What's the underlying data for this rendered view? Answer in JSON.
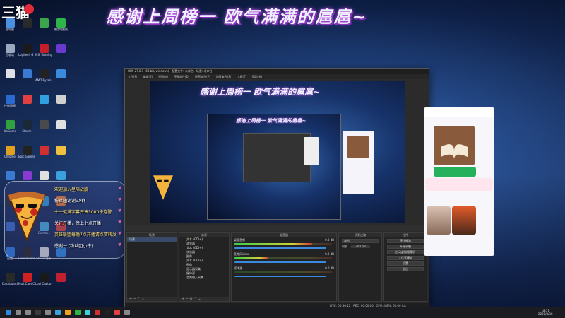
{
  "banner": {
    "text": "感谢上周榜一 欧气满满的扈扈~"
  },
  "logo": {
    "text": "三猫"
  },
  "desktop": {
    "icons": [
      {
        "label": "此电脑",
        "color": "#4a8fe0"
      },
      {
        "label": "",
        "color": "#2a2a2a"
      },
      {
        "label": "",
        "color": "#3aa54a"
      },
      {
        "label": "微信电脑版",
        "color": "#2db54a"
      },
      {
        "label": "回收站",
        "color": "#9aa8c0"
      },
      {
        "label": "Logitech G HUB",
        "color": "#1a1a1a"
      },
      {
        "label": "MSI Gaming APP",
        "color": "#c41e2a"
      },
      {
        "label": "",
        "color": "#6a3ad0"
      },
      {
        "label": "",
        "color": "#e0e0e8"
      },
      {
        "label": "",
        "color": "#3a7ad0"
      },
      {
        "label": "AMD Ryzen Master",
        "color": "#222"
      },
      {
        "label": "",
        "color": "#3a8ae0"
      },
      {
        "label": "控制面板",
        "color": "#2a6ad0"
      },
      {
        "label": "",
        "color": "#e04040"
      },
      {
        "label": "",
        "color": "#30a0e0"
      },
      {
        "label": "",
        "color": "#d0d0d0"
      },
      {
        "label": "WeGame",
        "color": "#30a040"
      },
      {
        "label": "Steam",
        "color": "#1b2838"
      },
      {
        "label": "",
        "color": "#4a4a4a"
      },
      {
        "label": "",
        "color": "#e0e0e0"
      },
      {
        "label": "Chrome",
        "color": "#e0a020"
      },
      {
        "label": "Epic Games Launcher",
        "color": "#222"
      },
      {
        "label": "",
        "color": "#d03030"
      },
      {
        "label": "",
        "color": "#f0c040"
      },
      {
        "label": "",
        "color": "#3a7ad0"
      },
      {
        "label": "",
        "color": "#8a3ad0"
      },
      {
        "label": "",
        "color": "#e0e0e0"
      },
      {
        "label": "",
        "color": "#3aa0e0"
      },
      {
        "label": "",
        "color": "#2a2a2a"
      },
      {
        "label": "",
        "color": "#c0a040"
      },
      {
        "label": "",
        "color": "#30a0e0"
      },
      {
        "label": "",
        "color": "#f08030"
      },
      {
        "label": "",
        "color": "#3a6ad0"
      },
      {
        "label": "",
        "color": "#2a2a2a"
      },
      {
        "label": "Connect",
        "color": "#4ab0e0"
      },
      {
        "label": "",
        "color": "#e04030"
      },
      {
        "label": "迅雷",
        "color": "#2a7ae0"
      },
      {
        "label": "Core VideoStudio",
        "color": "#222"
      },
      {
        "label": "Steam助手",
        "color": "#e0e0e0"
      },
      {
        "label": "",
        "color": "#2a8ae0"
      },
      {
        "label": "Dashboard",
        "color": "#2a2a2a"
      },
      {
        "label": "MultiCam Capture Lite",
        "color": "#d02020"
      },
      {
        "label": "Logi Capture",
        "color": "#1a1a1a"
      },
      {
        "label": "",
        "color": "#c02030"
      }
    ]
  },
  "obs": {
    "title": "OBS 27.0.1 (64-bit, windows) - 配置文件: 未命名 - 场景: 未命名",
    "menu": [
      "文件(F)",
      "编辑(E)",
      "视图(V)",
      "停靠部件(D)",
      "配置文件(P)",
      "场景集合(S)",
      "工具(T)",
      "帮助(H)"
    ],
    "preview_banner": "感谢上周榜一 欧气满满的扈扈~",
    "nested_banner": "感谢上周榜一 欧气满满的扈扈~",
    "docks": {
      "scenes": {
        "title": "场景",
        "items": [
          "场景"
        ]
      },
      "sources": {
        "title": "来源",
        "items": [
          "文本 (GDI+)",
          "浏览器",
          "文本 (GDI+)",
          "浏览器",
          "图像",
          "文本 (GDI+)",
          "图像",
          "显示器采集",
          "媒体源",
          "音频输入采集"
        ]
      },
      "mixer": {
        "title": "混音器",
        "channels": [
          {
            "name": "桌面音频",
            "value": "0.0 dB",
            "level": 0.8
          },
          {
            "name": "麦克风/Aux",
            "value": "0.0 dB",
            "level": 0.35
          },
          {
            "name": "媒体源",
            "value": "0.0 dB",
            "level": 0.0
          }
        ]
      },
      "transitions": {
        "title": "场景过渡",
        "selected": "淡出",
        "duration_label": "时长",
        "duration": "300 ms"
      },
      "controls": {
        "title": "控件",
        "buttons": [
          "停止推流",
          "开始录制",
          "启动虚拟摄像机",
          "工作室模式",
          "设置",
          "退出"
        ]
      }
    },
    "status": {
      "live": "LIVE: 00:36:12",
      "rec": "REC: 00:00:00",
      "cpu": "CPU: 4.8%, 60.00 fps"
    }
  },
  "chat": {
    "lines": [
      {
        "text": "欢迎加入星际战舰",
        "color": "#ffe070"
      },
      {
        "text": "粉丝团谢谢VX群",
        "color": "#ffffff"
      },
      {
        "text": "十一驱满字幕开售3000卡连警",
        "color": "#ffe070"
      },
      {
        "text": "关注开播，晚上七点开播",
        "color": "#ffffff"
      },
      {
        "text": "英雄联盟每晚7点开播请点赞转发",
        "color": "#ffe070"
      },
      {
        "text": "感谢一 (粉丝团小牛)",
        "color": "#ffffff"
      }
    ]
  },
  "tray": {
    "time": "18:51",
    "date": "2021/8/30"
  },
  "colors": {
    "obs_bg": "#2b2b2b",
    "accent_green": "#25b05b",
    "live_blue": "#3a8ae0"
  }
}
